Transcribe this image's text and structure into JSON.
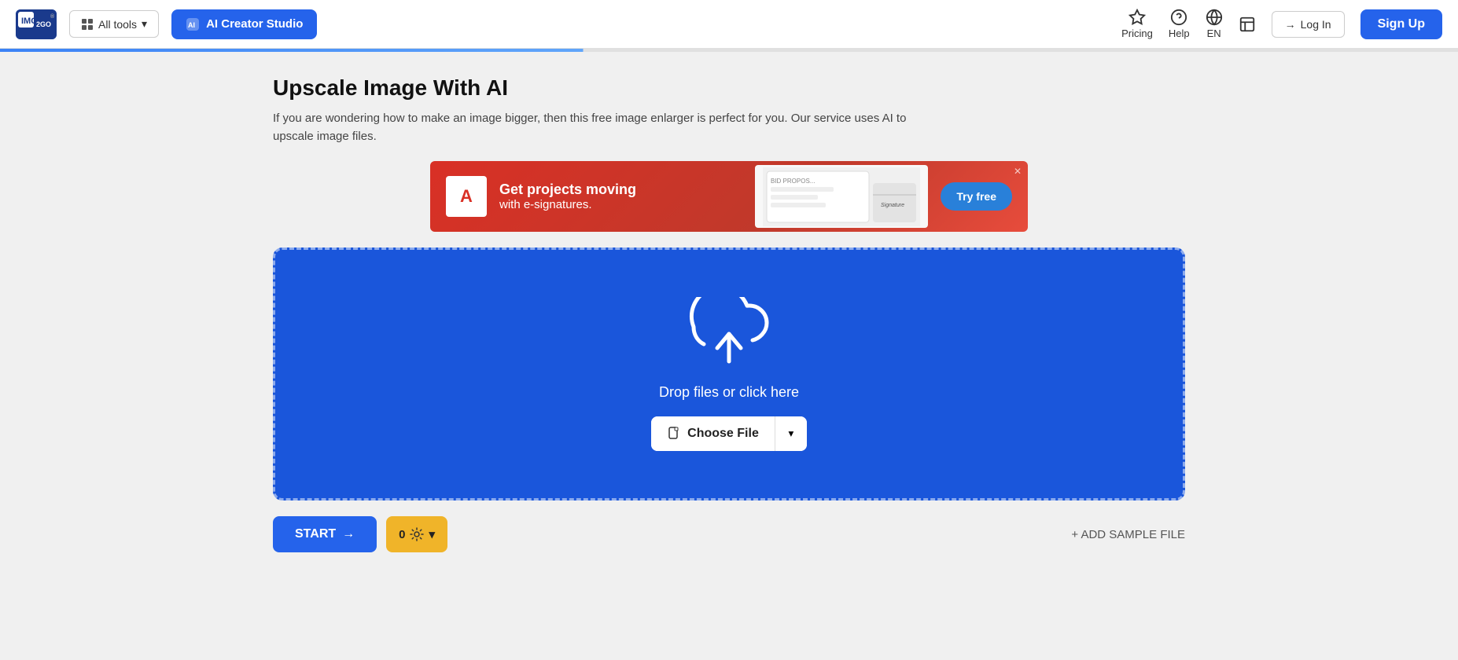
{
  "header": {
    "logo_text": "IMG2GO",
    "all_tools_label": "All tools",
    "ai_creator_label": "AI Creator Studio",
    "pricing_label": "Pricing",
    "help_label": "Help",
    "lang_label": "EN",
    "history_label": "",
    "login_label": "Log In",
    "signup_label": "Sign Up"
  },
  "page": {
    "title": "Upscale Image With AI",
    "description": "If you are wondering how to make an image bigger, then this free image enlarger is perfect for you. Our service uses AI to upscale image files."
  },
  "ad": {
    "brand": "Adobe",
    "headline": "Get projects moving",
    "subline": "with e-signatures.",
    "cta": "Try free"
  },
  "upload": {
    "drop_text": "Drop files or click here",
    "choose_file_label": "Choose File"
  },
  "bottom": {
    "start_label": "START",
    "settings_count": "0",
    "add_sample_label": "+ ADD SAMPLE FILE"
  }
}
